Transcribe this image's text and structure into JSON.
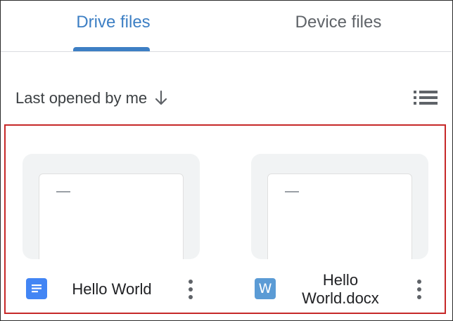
{
  "tabs": [
    {
      "label": "Drive files",
      "active": true
    },
    {
      "label": "Device files",
      "active": false
    }
  ],
  "sort": {
    "label": "Last opened by me",
    "direction_icon": "arrow-down-icon"
  },
  "view_toggle": {
    "icon": "list-view-icon"
  },
  "files": [
    {
      "name": "Hello World",
      "type_icon": "google-docs-icon"
    },
    {
      "name_line1": "Hello",
      "name_line2": "World.docx",
      "type_icon": "word-icon",
      "type_letter": "W"
    }
  ],
  "colors": {
    "accent": "#3d7fc4",
    "selection_border": "#c62828",
    "docs_blue": "#4285f4",
    "word_blue": "#5b9bd5"
  }
}
